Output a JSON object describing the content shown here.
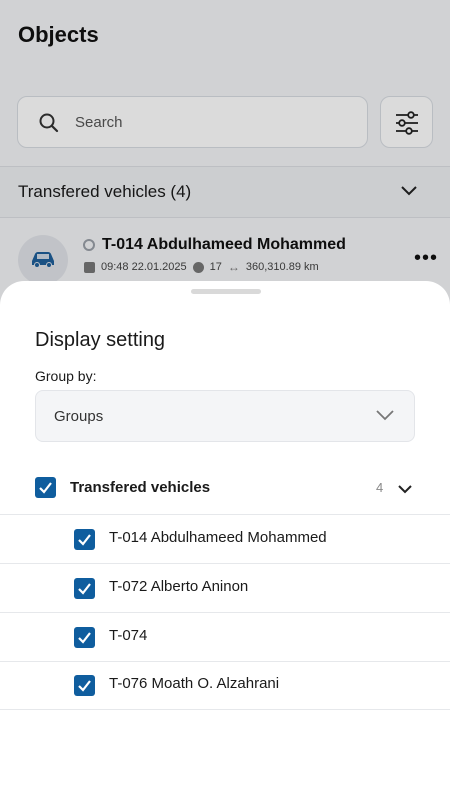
{
  "background": {
    "title": "Objects",
    "search": {
      "placeholder": "Search"
    },
    "group_header": {
      "label": "Transfered vehicles (4)"
    },
    "object_row": {
      "name": "T-014 Abdulhameed Mohammed",
      "time": "09:48 22.01.2025",
      "satellites": "17",
      "mileage": "360,310.89 km"
    }
  },
  "sheet": {
    "title": "Display setting",
    "group_by_label": "Group by:",
    "group_by_value": "Groups",
    "group": {
      "name": "Transfered vehicles",
      "count": "4",
      "checked": true
    },
    "items": [
      {
        "label": "T-014 Abdulhameed Mohammed",
        "checked": true
      },
      {
        "label": "T-072 Alberto Aninon",
        "checked": true
      },
      {
        "label": "T-074",
        "checked": true
      },
      {
        "label": "T-076 Moath O. Alzahrani",
        "checked": true
      }
    ]
  },
  "colors": {
    "checkbox": "#0f5d9e",
    "vehicle_icon": "#1f5f9a"
  }
}
